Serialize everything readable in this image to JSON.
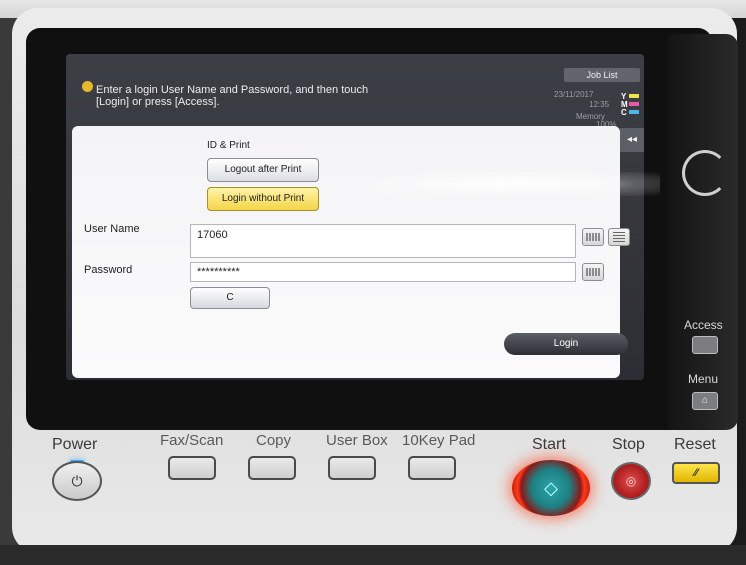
{
  "screen": {
    "message": "Enter a login User Name and Password, and then touch [Login] or press [Access].",
    "job_list": "Job List",
    "status": {
      "date": "23/11/2017",
      "time": "12:35",
      "memory": "Memory",
      "percent": "100%"
    },
    "toner": [
      {
        "letter": "Y",
        "color": "#f2e34c"
      },
      {
        "letter": "M",
        "color": "#e65aa6"
      },
      {
        "letter": "C",
        "color": "#4fb6e8"
      }
    ],
    "collapse": "◂◂",
    "section_label": "ID & Print",
    "logout_after_print": "Logout after Print",
    "login_without_print": "Login without Print",
    "user_name_label": "User Name",
    "user_name_value": "17060",
    "password_label": "Password",
    "password_value": "**********",
    "clear_button": "C",
    "login_button": "Login"
  },
  "side_keys": {
    "access": "Access",
    "menu": "Menu"
  },
  "hardware_keys": {
    "power": "Power",
    "fax_scan": "Fax/Scan",
    "copy": "Copy",
    "user_box": "User Box",
    "tenkey": "10Key Pad",
    "start": "Start",
    "stop": "Stop",
    "reset": "Reset"
  },
  "colors": {
    "selected_button": "#f3d64a",
    "start_glow": "#ff3a1a",
    "power_led": "#3da8ff"
  }
}
